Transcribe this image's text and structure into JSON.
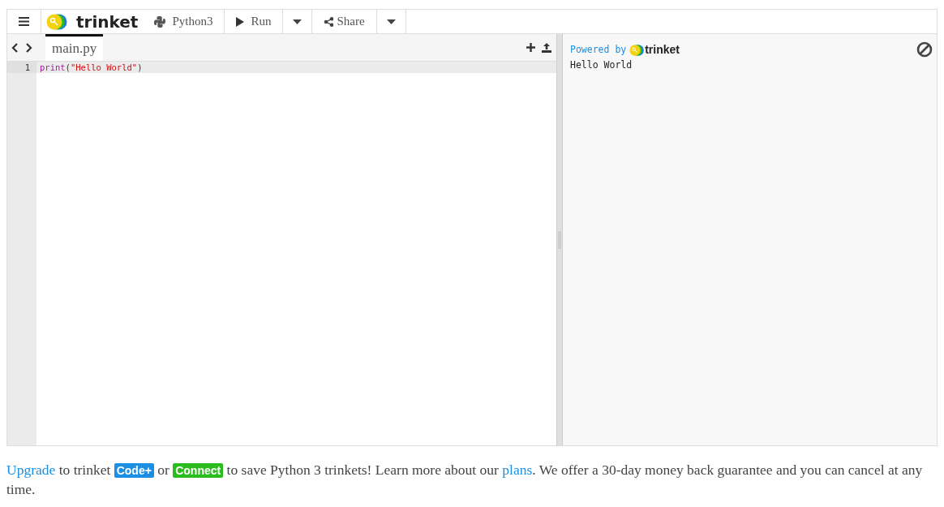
{
  "toolbar": {
    "logo_text": "trinket",
    "language": "Python3",
    "run_label": "Run",
    "share_label": "Share"
  },
  "editor": {
    "tabs": [
      {
        "label": "main.py",
        "selected": true
      }
    ],
    "lines": [
      {
        "number": "1",
        "tokens": [
          {
            "kind": "builtin",
            "text": "print"
          },
          {
            "kind": "punct",
            "text": "("
          },
          {
            "kind": "string",
            "text": "\"Hello World\""
          },
          {
            "kind": "punct",
            "text": ")"
          }
        ]
      }
    ]
  },
  "output": {
    "powered_by": "Powered by",
    "logo_text": "trinket",
    "lines": [
      "Hello World"
    ]
  },
  "footer": [
    {
      "kind": "link",
      "text": "Upgrade"
    },
    {
      "kind": "text",
      "text": " to trinket "
    },
    {
      "kind": "badge",
      "text": "Code+",
      "color": "#1a8fe3"
    },
    {
      "kind": "text",
      "text": " or "
    },
    {
      "kind": "badge",
      "text": "Connect",
      "color": "#2bbd1e"
    },
    {
      "kind": "text",
      "text": " to save Python 3 trinkets! Learn more about our "
    },
    {
      "kind": "link",
      "text": "plans"
    },
    {
      "kind": "text",
      "text": ". We offer a 30-day money back guarantee and you can cancel at any time."
    }
  ]
}
